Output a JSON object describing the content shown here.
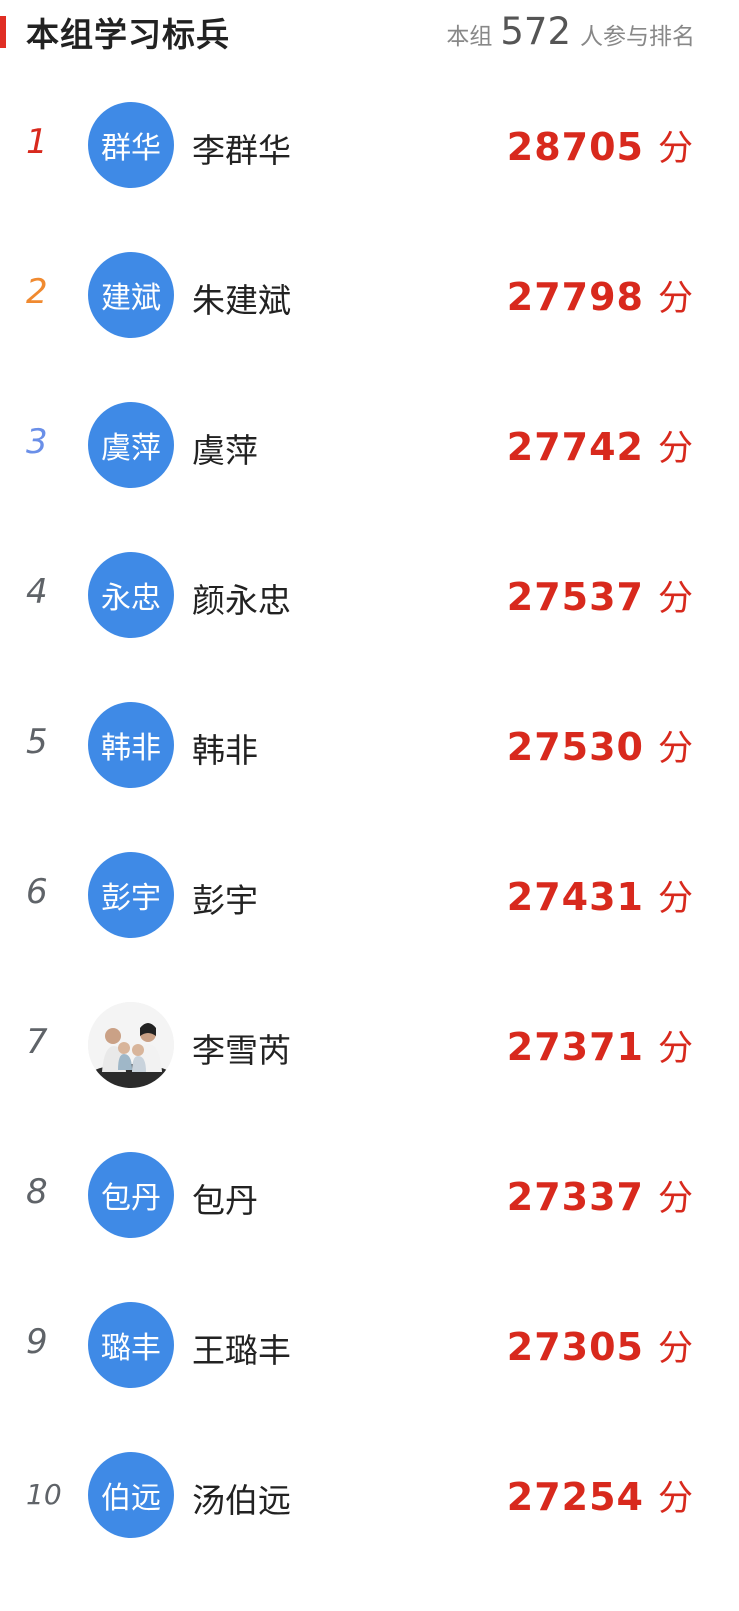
{
  "header": {
    "title": "本组学习标兵",
    "prefix": "本组",
    "count": "572",
    "suffix": "人参与排名",
    "accent_color": "#e02e24"
  },
  "colors": {
    "rank1": "#d8291d",
    "rank2": "#f08a30",
    "rank3": "#6a8fe8",
    "rank_default": "#5f6368",
    "avatar_bg": "#3f8ae6",
    "score": "#d8291d"
  },
  "score_unit": "分",
  "rows": [
    {
      "rank": "1",
      "avatar_text": "群华",
      "name": "李群华",
      "score": "28705"
    },
    {
      "rank": "2",
      "avatar_text": "建斌",
      "name": "朱建斌",
      "score": "27798"
    },
    {
      "rank": "3",
      "avatar_text": "虞萍",
      "name": "虞萍",
      "score": "27742"
    },
    {
      "rank": "4",
      "avatar_text": "永忠",
      "name": "颜永忠",
      "score": "27537"
    },
    {
      "rank": "5",
      "avatar_text": "韩非",
      "name": "韩非",
      "score": "27530"
    },
    {
      "rank": "6",
      "avatar_text": "彭宇",
      "name": "彭宇",
      "score": "27431"
    },
    {
      "rank": "7",
      "avatar_text": "",
      "avatar_icon": "family-photo-icon",
      "name": "李雪芮",
      "score": "27371"
    },
    {
      "rank": "8",
      "avatar_text": "包丹",
      "name": "包丹",
      "score": "27337"
    },
    {
      "rank": "9",
      "avatar_text": "璐丰",
      "name": "王璐丰",
      "score": "27305"
    },
    {
      "rank": "10",
      "avatar_text": "伯远",
      "name": "汤伯远",
      "score": "27254"
    }
  ]
}
